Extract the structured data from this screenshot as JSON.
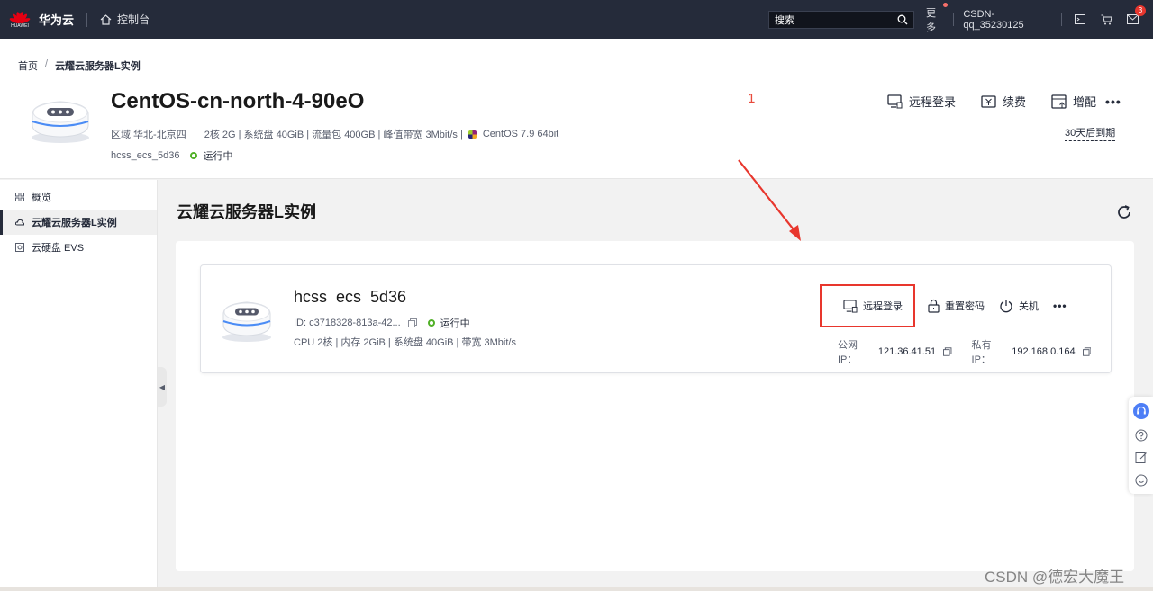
{
  "topbar": {
    "logo_text": "HUAWEI",
    "brand": "华为云",
    "console": "控制台",
    "search_placeholder": "搜索",
    "more": "更多",
    "user": "CSDN-qq_35230125",
    "notification_count": "3"
  },
  "breadcrumb": {
    "home": "首页",
    "separator": "/",
    "current": "云耀云服务器L实例"
  },
  "header": {
    "title": "CentOS-cn-north-4-90eO",
    "region": "区域 华北-北京四",
    "spec": "2核  2G | 系统盘 40GiB | 流量包 400GB | 峰值带宽 3Mbit/s |",
    "os": "CentOS 7.9 64bit",
    "instance": "hcss_ecs_5d36",
    "status": "运行中",
    "annotation": "1",
    "actions": {
      "remote_login": "远程登录",
      "renew": "续费",
      "upgrade": "增配"
    },
    "expire": "30天后到期"
  },
  "sidebar": {
    "items": [
      {
        "label": "概览",
        "icon": "grid-icon"
      },
      {
        "label": "云耀云服务器L实例",
        "icon": "cloud-icon",
        "active": true
      },
      {
        "label": "云硬盘 EVS",
        "icon": "disk-icon"
      }
    ]
  },
  "main": {
    "title": "云耀云服务器L实例",
    "instance": {
      "name": "hcss  ecs  5d36",
      "id": "ID: c3718328-813a-42...",
      "status": "运行中",
      "spec": "CPU 2核 | 内存 2GiB | 系统盘 40GiB | 带宽 3Mbit/s",
      "actions": {
        "remote_login": "远程登录",
        "reset_password": "重置密码",
        "shutdown": "关机"
      },
      "public_ip_label": "公网IP：",
      "public_ip": "121.36.41.51",
      "private_ip_label": "私有IP：",
      "private_ip": "192.168.0.164"
    }
  },
  "watermark": "CSDN @德宏大魔王",
  "colors": {
    "topbar": "#252b3a",
    "accent_red": "#e8362d",
    "running_green": "#50b027"
  }
}
